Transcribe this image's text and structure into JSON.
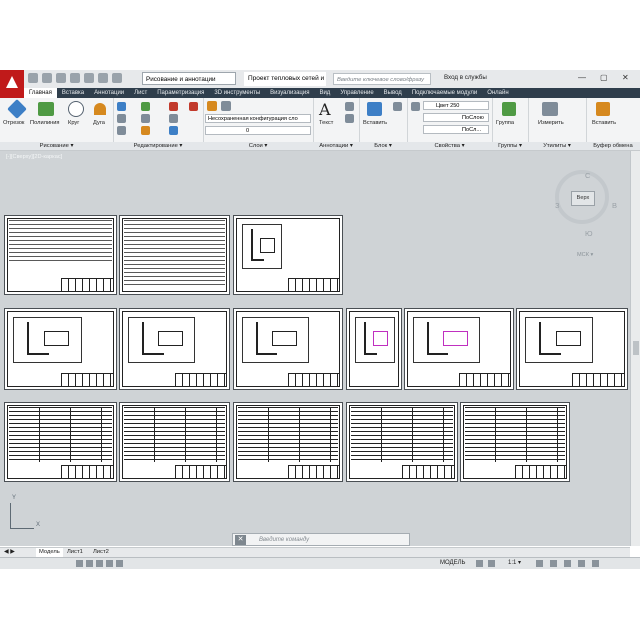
{
  "titlebar": {
    "workspace": "Рисование и аннотации",
    "document_title": "Проект тепловых сетей и ...",
    "search_placeholder": "Введите ключевое слово/фразу",
    "signin": "Вход в службы",
    "minimize": "—",
    "restore": "▢",
    "close": "✕"
  },
  "ribbon_tabs": [
    "Главная",
    "Вставка",
    "Аннотации",
    "Лист",
    "Параметризация",
    "3D инструменты",
    "Визуализация",
    "Вид",
    "Управление",
    "Вывод",
    "Подключаемые модули",
    "Онлайн"
  ],
  "panels": {
    "draw": {
      "title": "Рисование ▾",
      "line": "Отрезок",
      "polyline": "Полилиния",
      "circle": "Круг",
      "arc": "Дуга"
    },
    "modify": {
      "title": "Редактирование ▾"
    },
    "layers": {
      "title": "Слои ▾",
      "layer_state": "Несохраненная конфигурация сло",
      "current_layer": "0"
    },
    "annotation": {
      "title": "Аннотации ▾",
      "text": "Текст"
    },
    "block": {
      "title": "Блок ▾",
      "insert": "Вставить"
    },
    "properties": {
      "title": "Свойства ▾",
      "color": "Цвет 250",
      "linetype": "ПоСлою",
      "lineweight": "ПоСл..."
    },
    "groups": {
      "title": "Группы ▾",
      "group": "Группа"
    },
    "utilities": {
      "title": "Утилиты ▾",
      "measure": "Измерить"
    },
    "clipboard": {
      "title": "Буфер обмена",
      "paste": "Вставить"
    }
  },
  "viewport": {
    "label": "[-][Сверху][2D-каркас]"
  },
  "viewcube": {
    "top": "Верх",
    "north": "С",
    "south": "Ю",
    "west": "З",
    "east": "В",
    "wcs": "МСК ▾"
  },
  "ucs": {
    "x": "X",
    "y": "Y"
  },
  "command": {
    "close": "✕",
    "placeholder": "Введите команду"
  },
  "layout_tabs": [
    "Модель",
    "Лист1",
    "Лист2"
  ],
  "status": {
    "model": "МОДЕЛЬ",
    "scale": "1:1 ▾"
  }
}
